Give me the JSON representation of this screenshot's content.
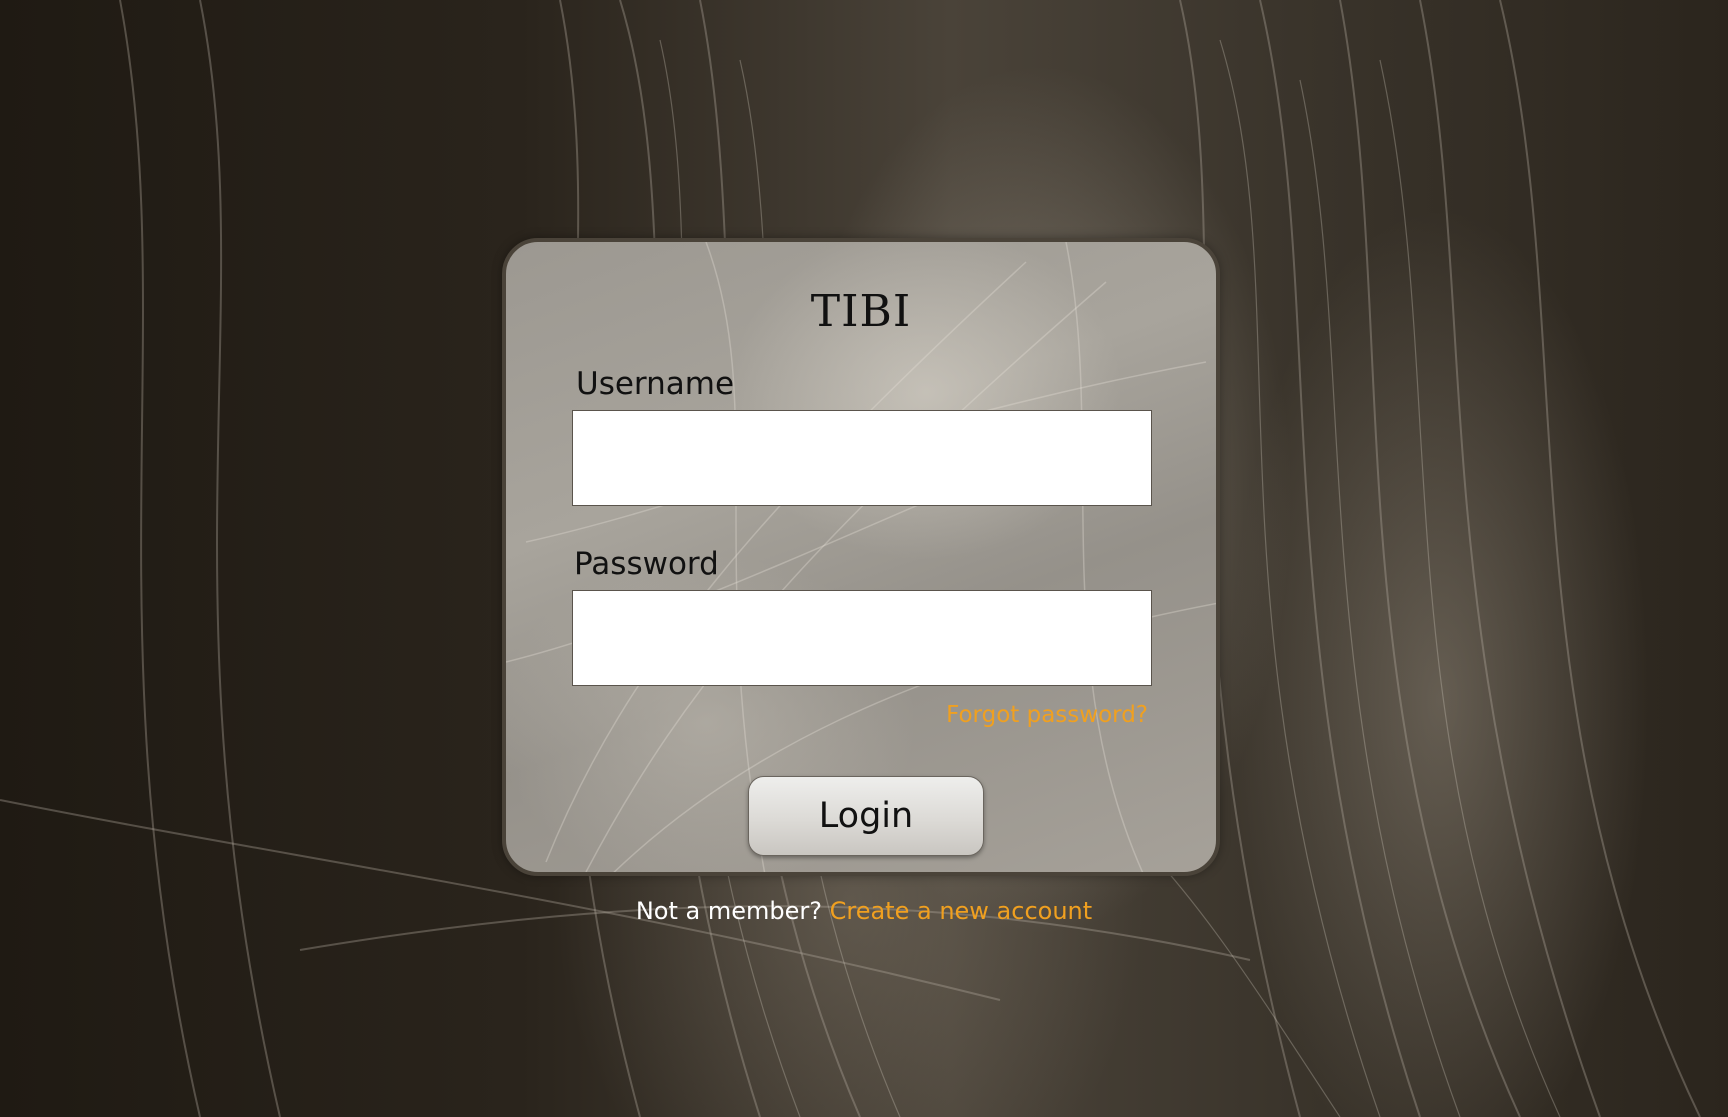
{
  "brand": {
    "title": "TIBI"
  },
  "form": {
    "username_label": "Username",
    "username_value": "",
    "password_label": "Password",
    "password_value": "",
    "forgot_link": "Forgot password?",
    "login_button": "Login"
  },
  "footer": {
    "prompt": "Not a member?",
    "signup_link": "Create a new account"
  },
  "colors": {
    "accent_link": "#f0a020",
    "background": "#231d16",
    "card": "#9c9891"
  }
}
